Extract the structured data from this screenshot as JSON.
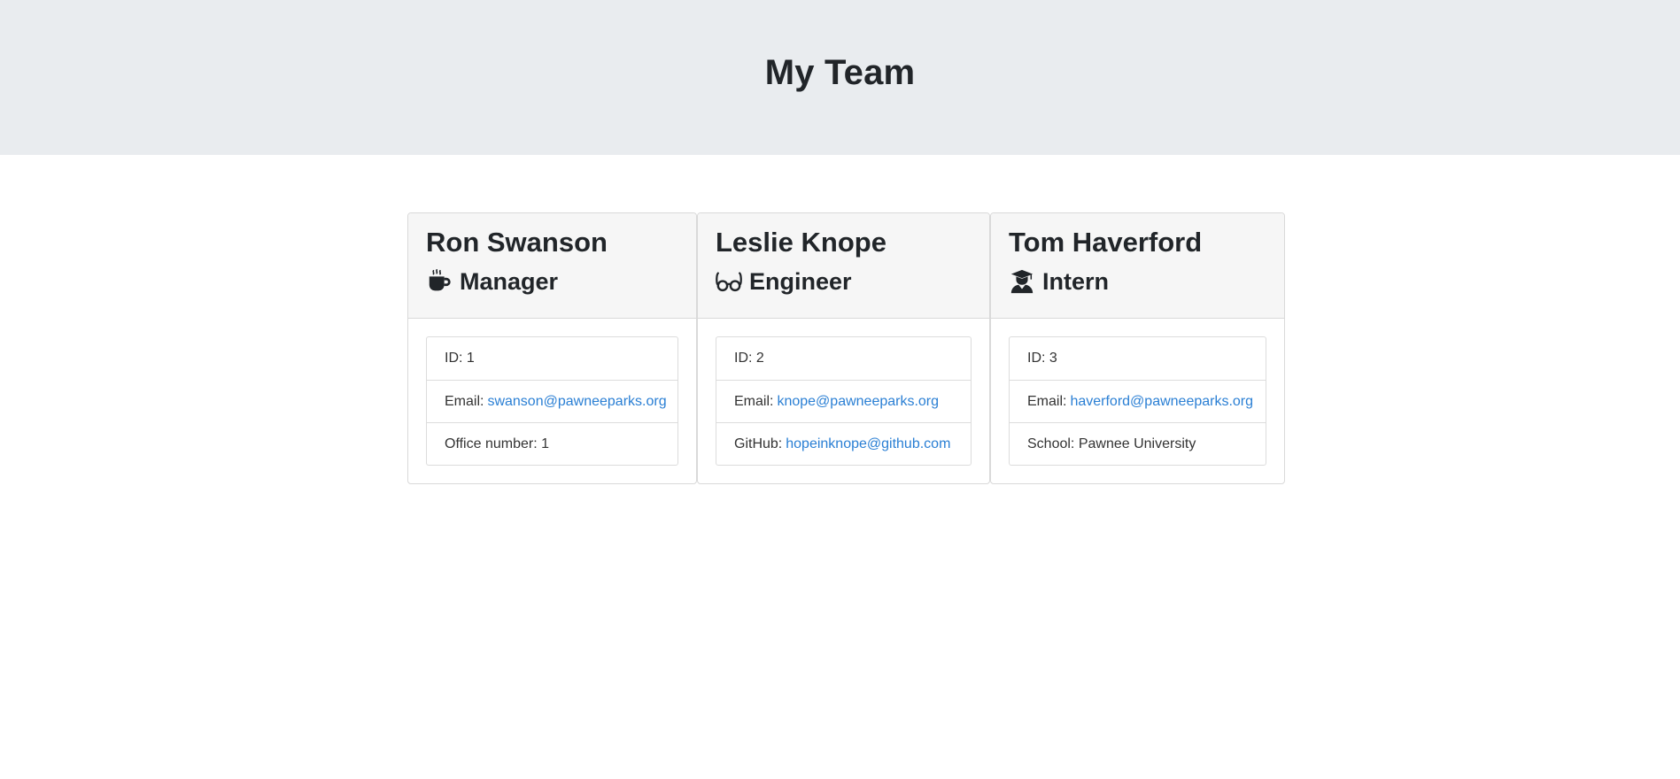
{
  "header": {
    "title": "My Team"
  },
  "team": [
    {
      "name": "Ron Swanson",
      "role": "Manager",
      "role_icon": "coffee-icon",
      "id_label": "ID: 1",
      "email_label": "Email:",
      "email": "swanson@pawneeparks.org",
      "extra_label": "Office number: 1",
      "extra_link": ""
    },
    {
      "name": "Leslie Knope",
      "role": "Engineer",
      "role_icon": "glasses-icon",
      "id_label": "ID: 2",
      "email_label": "Email:",
      "email": "knope@pawneeparks.org",
      "extra_label": "GitHub:",
      "extra_link": "hopeinknope@github.com"
    },
    {
      "name": "Tom Haverford",
      "role": "Intern",
      "role_icon": "graduate-icon",
      "id_label": "ID: 3",
      "email_label": "Email:",
      "email": "haverford@pawneeparks.org",
      "extra_label": "School: Pawnee University",
      "extra_link": ""
    }
  ],
  "colors": {
    "header_bg": "#e9ecef",
    "link": "#2a7fd4",
    "card_header_bg": "#f6f6f6"
  }
}
